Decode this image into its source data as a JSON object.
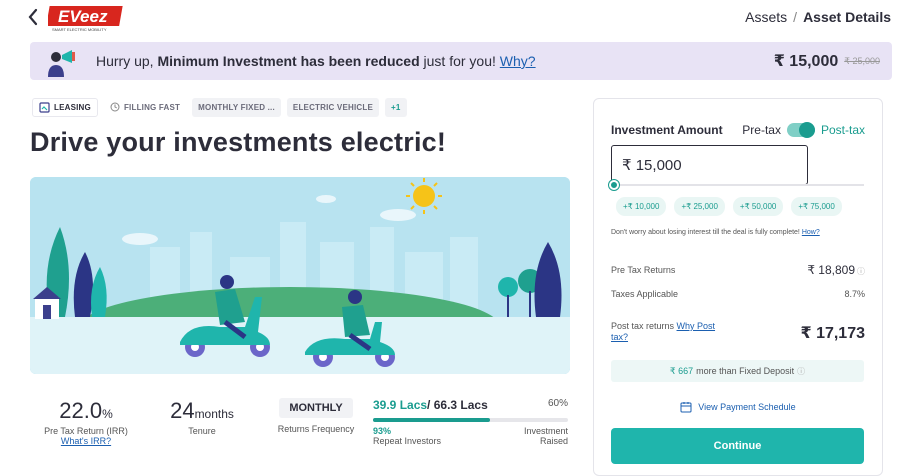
{
  "header": {
    "breadcrumb": [
      "Assets",
      "/",
      "Asset Details"
    ],
    "logo_text": "EVeez"
  },
  "banner": {
    "text_pre": "Hurry up, ",
    "text_bold": "Minimum Investment has been reduced",
    "text_post": " just for you! ",
    "link": "Why?",
    "price": "₹ 15,000",
    "old_price": "₹ 25,000"
  },
  "tags": [
    "LEASING",
    "FILLING FAST",
    "MONTHLY FIXED ...",
    "ELECTRIC VEHICLE",
    "+1"
  ],
  "title": "Drive your investments electric!",
  "stats": {
    "irr_value": "22.0",
    "irr_unit": "%",
    "irr_label": "Pre Tax Return (IRR)",
    "irr_link": "What's IRR?",
    "tenure_value": "24",
    "tenure_unit": "months",
    "tenure_label": "Tenure",
    "frequency": "MONTHLY",
    "frequency_label": "Returns Frequency",
    "raised": "39.9 Lacs",
    "target": "/ 66.3 Lacs",
    "raised_pct": "60%",
    "progress": 0.6,
    "repeat_pct": "93%",
    "repeat_label": "Repeat Investors",
    "invested_label_1": "Investment",
    "invested_label_2": "Raised"
  },
  "panel": {
    "heading": "Investment Amount",
    "pre_tax": "Pre-tax",
    "post_tax": "Post-tax",
    "amount": "₹ 15,000",
    "quick_amounts": [
      "+₹ 10,000",
      "+₹ 25,000",
      "+₹ 50,000",
      "+₹ 75,000"
    ],
    "note": "Don't worry about losing interest till the deal is fully complete! ",
    "note_link": "How?",
    "pre_tax_returns_label": "Pre Tax Returns",
    "pre_tax_returns_value": "₹ 18,809",
    "taxes_label": "Taxes Applicable",
    "taxes_value": "8.7%",
    "post_tax_label": "Post tax returns ",
    "post_tax_link": "Why Post tax?",
    "post_tax_value": "₹ 17,173",
    "fd_value": "₹ 667",
    "fd_text": "more than Fixed Deposit",
    "schedule": "View Payment Schedule",
    "cta": "Continue"
  }
}
